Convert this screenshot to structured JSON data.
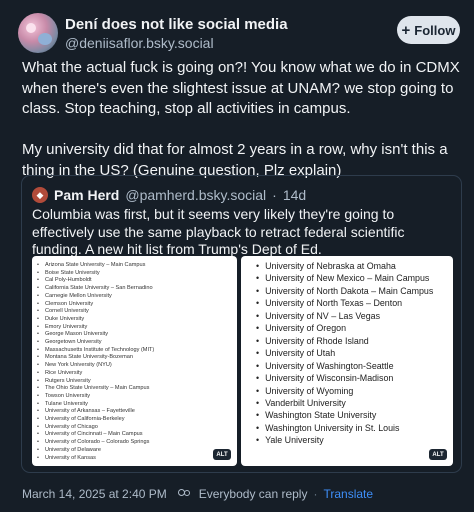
{
  "post": {
    "author_name": "Dení does not like social media",
    "author_handle": "@deniisaflor.bsky.social",
    "follow_label": "Follow",
    "text": "What the actual fuck is going on?! You know what we do in CDMX when there's even the slightest issue at UNAM? we stop going to class. Stop teaching, stop all activities in campus.\n\nMy university did that for almost 2 years in a row, why isn't this a thing in the US? (Genuine question, Plz explain)",
    "timestamp": "March 14, 2025 at 2:40 PM",
    "reply_setting": "Everybody can reply",
    "translate_label": "Translate"
  },
  "quote": {
    "author_name": "Pam Herd",
    "author_handle": "@pamherd.bsky.social",
    "age": "14d",
    "text": "Columbia was first, but it seems very likely they're going to effectively use the same playback to retract federal scientific funding.  A new hit list from Trump's Dept of Ed.  www.ed.gov/about/news/p...",
    "alt_badge": "ALT",
    "left_list": [
      "Arizona State University – Main Campus",
      "Boise State University",
      "Cal Poly-Humboldt",
      "California State University – San Bernadino",
      "Carnegie Mellon University",
      "Clemson University",
      "Cornell University",
      "Duke University",
      "Emory University",
      "George Mason University",
      "Georgetown University",
      "Massachusetts Institute of Technology (MIT)",
      "Montana State University-Bozeman",
      "New York University (NYU)",
      "Rice University",
      "Rutgers University",
      "The Ohio State University – Main Campus",
      "Towson University",
      "Tulane University",
      "University of Arkansas – Fayetteville",
      "University of California-Berkeley",
      "University of Chicago",
      "University of Cincinnati – Main Campus",
      "University of Colorado – Colorado Springs",
      "University of Delaware",
      "University of Kansas"
    ],
    "right_list": [
      "University of Nebraska at Omaha",
      "University of New Mexico – Main Campus",
      "University of North Dakota – Main Campus",
      "University of North Texas – Denton",
      "University of NV – Las Vegas",
      "University of Oregon",
      "University of Rhode Island",
      "University of Utah",
      "University of Washington-Seattle",
      "University of Wisconsin-Madison",
      "University of Wyoming",
      "Vanderbilt University",
      "Washington State University",
      "Washington University in St. Louis",
      "Yale University"
    ]
  },
  "colors": {
    "background": "#161e27",
    "accent": "#3e8ef7"
  },
  "icons": {
    "plus": "plus-icon",
    "people": "people-icon"
  }
}
